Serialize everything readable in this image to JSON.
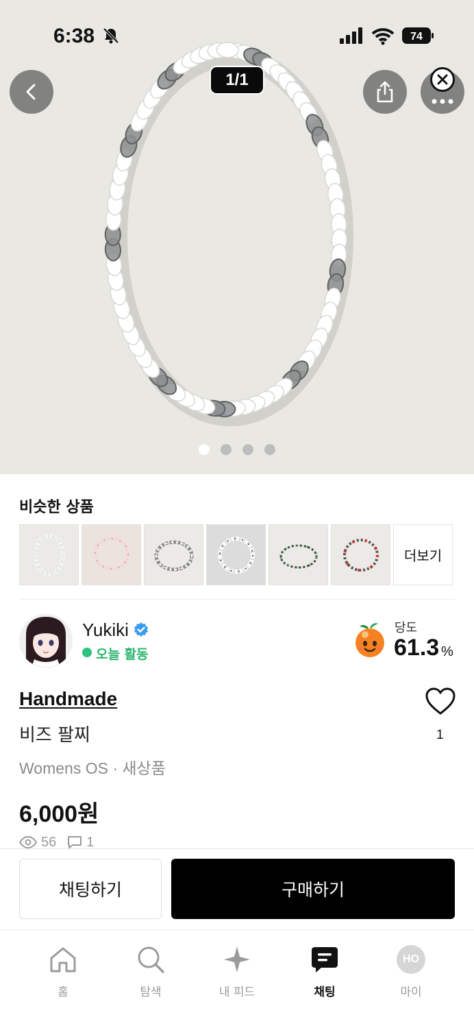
{
  "status_bar": {
    "time": "6:38",
    "battery": "74"
  },
  "gallery": {
    "counter": "1/1",
    "page_count": 4,
    "active_page": 1
  },
  "similar": {
    "title": "비슷한 상품",
    "more_label": "더보기"
  },
  "seller": {
    "name": "Yukiki",
    "verified": true,
    "activity": "오늘 활동",
    "sweetness_label": "당도",
    "sweetness_value": "61.3",
    "sweetness_unit": "%"
  },
  "product": {
    "brand": "Handmade",
    "name": "비즈 팔찌",
    "meta": "Womens OS · 새상품",
    "price": "6,000원",
    "likes": "1",
    "views": "56",
    "comments": "1"
  },
  "actions": {
    "chat": "채팅하기",
    "buy": "구매하기"
  },
  "tabs": [
    {
      "label": "홈",
      "icon": "home-icon"
    },
    {
      "label": "탐색",
      "icon": "search-icon"
    },
    {
      "label": "내 피드",
      "icon": "sparkle-icon"
    },
    {
      "label": "채팅",
      "icon": "chat-icon",
      "active": true
    },
    {
      "label": "마이",
      "icon": "avatar-icon",
      "avatar_text": "HO"
    }
  ],
  "colors": {
    "accent": "#000000",
    "active_green": "#2ec27e",
    "verified_blue": "#3b9cf2"
  }
}
